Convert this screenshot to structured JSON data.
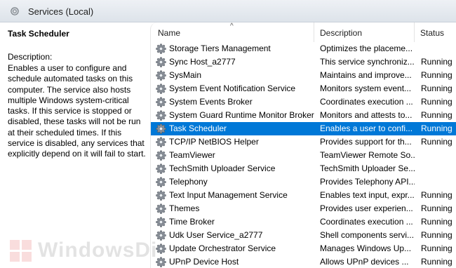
{
  "header": {
    "title": "Services (Local)"
  },
  "detail": {
    "service_name": "Task Scheduler",
    "description_label": "Description:",
    "description": "Enables a user to configure and schedule automated tasks on this computer. The service also hosts multiple Windows system-critical tasks. If this service is stopped or disabled, these tasks will not be run at their scheduled times. If this service is disabled, any services that explicitly depend on it will fail to start."
  },
  "columns": {
    "name": "Name",
    "description": "Description",
    "status": "Status",
    "sort_indicator": "^"
  },
  "services": [
    {
      "name": "Storage Tiers Management",
      "description": "Optimizes the placeme...",
      "status": ""
    },
    {
      "name": "Sync Host_a2777",
      "description": "This service synchroniz...",
      "status": "Running"
    },
    {
      "name": "SysMain",
      "description": "Maintains and improve...",
      "status": "Running"
    },
    {
      "name": "System Event Notification Service",
      "description": "Monitors system event...",
      "status": "Running"
    },
    {
      "name": "System Events Broker",
      "description": "Coordinates execution ...",
      "status": "Running"
    },
    {
      "name": "System Guard Runtime Monitor Broker",
      "description": "Monitors and attests to...",
      "status": "Running"
    },
    {
      "name": "Task Scheduler",
      "description": "Enables a user to confi...",
      "status": "Running",
      "selected": true
    },
    {
      "name": "TCP/IP NetBIOS Helper",
      "description": "Provides support for th...",
      "status": "Running"
    },
    {
      "name": "TeamViewer",
      "description": "TeamViewer Remote So...",
      "status": ""
    },
    {
      "name": "TechSmith Uploader Service",
      "description": "TechSmith Uploader Se...",
      "status": ""
    },
    {
      "name": "Telephony",
      "description": "Provides Telephony API...",
      "status": ""
    },
    {
      "name": "Text Input Management Service",
      "description": "Enables text input, expr...",
      "status": "Running"
    },
    {
      "name": "Themes",
      "description": "Provides user experien...",
      "status": "Running"
    },
    {
      "name": "Time Broker",
      "description": "Coordinates execution ...",
      "status": "Running"
    },
    {
      "name": "Udk User Service_a2777",
      "description": "Shell components servi...",
      "status": "Running"
    },
    {
      "name": "Update Orchestrator Service",
      "description": "Manages Windows Up...",
      "status": "Running"
    },
    {
      "name": "UPnP Device Host",
      "description": "Allows UPnP devices ...",
      "status": "Running"
    }
  ],
  "watermark": {
    "text": "WindowsDi"
  },
  "colors": {
    "selection": "#0078d7",
    "header_bg": "#e4e8ee"
  }
}
